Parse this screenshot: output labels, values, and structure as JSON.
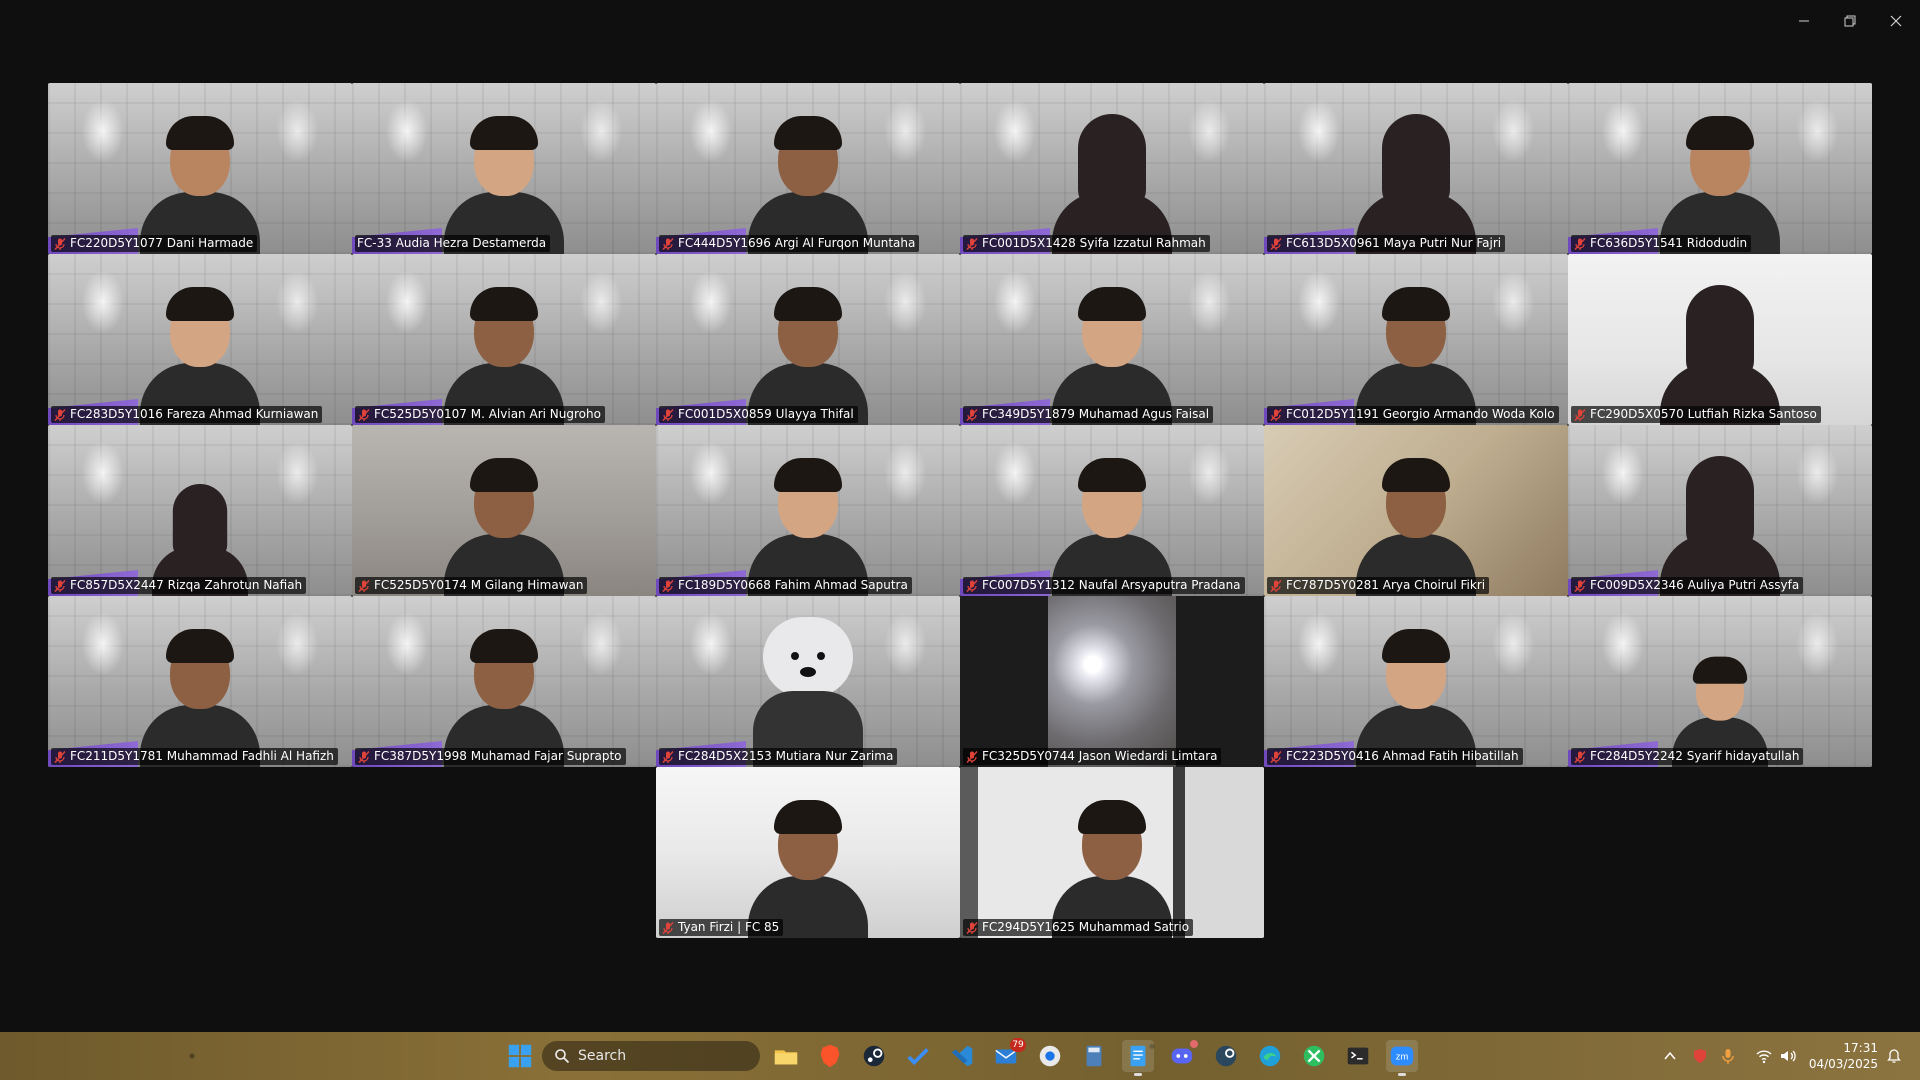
{
  "window": {
    "controls": {
      "minimize": "minimize-icon",
      "restore": "restore-icon",
      "close": "close-icon"
    }
  },
  "accent_colors": {
    "active_speaker": "#2ad18f",
    "muted_icon": "#e0433a",
    "badge": "#c42b1c"
  },
  "participants": [
    {
      "name": "FC220D5Y1077 Dani Harmade",
      "muted": true
    },
    {
      "name": "FC-33 Audia Hezra Destamerda",
      "muted": false,
      "active_speaker": true
    },
    {
      "name": "FC444D5Y1696 Argi Al Furqon Muntaha",
      "muted": true
    },
    {
      "name": "FC001D5X1428 Syifa Izzatul Rahmah",
      "muted": true
    },
    {
      "name": "FC613D5X0961 Maya Putri Nur Fajri",
      "muted": true
    },
    {
      "name": "FC636D5Y1541 Ridodudin",
      "muted": true
    },
    {
      "name": "FC283D5Y1016 Fareza Ahmad Kurniawan",
      "muted": true
    },
    {
      "name": "FC525D5Y0107 M. Alvian Ari Nugroho",
      "muted": true
    },
    {
      "name": "FC001D5X0859 Ulayya Thifal",
      "muted": true
    },
    {
      "name": "FC349D5Y1879 Muhamad Agus Faisal",
      "muted": true
    },
    {
      "name": "FC012D5Y1191 Georgio Armando Woda Kolo",
      "muted": true
    },
    {
      "name": "FC290D5X0570 Lutfiah Rizka Santoso",
      "muted": true
    },
    {
      "name": "FC857D5X2447 Rizqa Zahrotun Nafiah",
      "muted": true
    },
    {
      "name": "FC525D5Y0174 M Gilang Himawan",
      "muted": true
    },
    {
      "name": "FC189D5Y0668 Fahim Ahmad Saputra",
      "muted": true
    },
    {
      "name": "FC007D5Y1312 Naufal Arsyaputra Pradana",
      "muted": true
    },
    {
      "name": "FC787D5Y0281 Arya Choirul Fikri",
      "muted": true
    },
    {
      "name": "FC009D5X2346 Auliya Putri Assyfa",
      "muted": true
    },
    {
      "name": "FC211D5Y1781 Muhammad Fadhli Al Hafizh",
      "muted": true
    },
    {
      "name": "FC387D5Y1998 Muhamad Fajar Suprapto",
      "muted": true
    },
    {
      "name": "FC284D5X2153 Mutiara Nur Zarima",
      "muted": true
    },
    {
      "name": "FC325D5Y0744 Jason Wiedardi Limtara",
      "muted": true
    },
    {
      "name": "FC223D5Y0416 Ahmad Fatih Hibatillah",
      "muted": true
    },
    {
      "name": "FC284D5Y2242 Syarif hidayatullah",
      "muted": true
    },
    {
      "name": "Tyan Firzi | FC 85",
      "muted": true
    },
    {
      "name": "FC294D5Y1625 Muhammad Satrio",
      "muted": true
    }
  ],
  "taskbar": {
    "search_placeholder": "Search",
    "apps": [
      {
        "icon": "windows-start-icon"
      },
      {
        "icon": "widgets-icon"
      },
      {
        "icon": "file-explorer-icon"
      },
      {
        "icon": "brave-browser-icon"
      },
      {
        "icon": "steam-icon"
      },
      {
        "icon": "todo-check-icon"
      },
      {
        "icon": "vscode-icon"
      },
      {
        "icon": "mail-icon",
        "badge": "79"
      },
      {
        "icon": "chrome-icon"
      },
      {
        "icon": "calculator-icon"
      },
      {
        "icon": "notepad-icon"
      },
      {
        "icon": "discord-icon"
      },
      {
        "icon": "steam-alt-icon"
      },
      {
        "icon": "edge-icon"
      },
      {
        "icon": "xbox-icon"
      },
      {
        "icon": "terminal-icon"
      },
      {
        "icon": "zoom-icon"
      }
    ],
    "tray": {
      "time": "17:31",
      "date": "04/03/2025"
    }
  }
}
